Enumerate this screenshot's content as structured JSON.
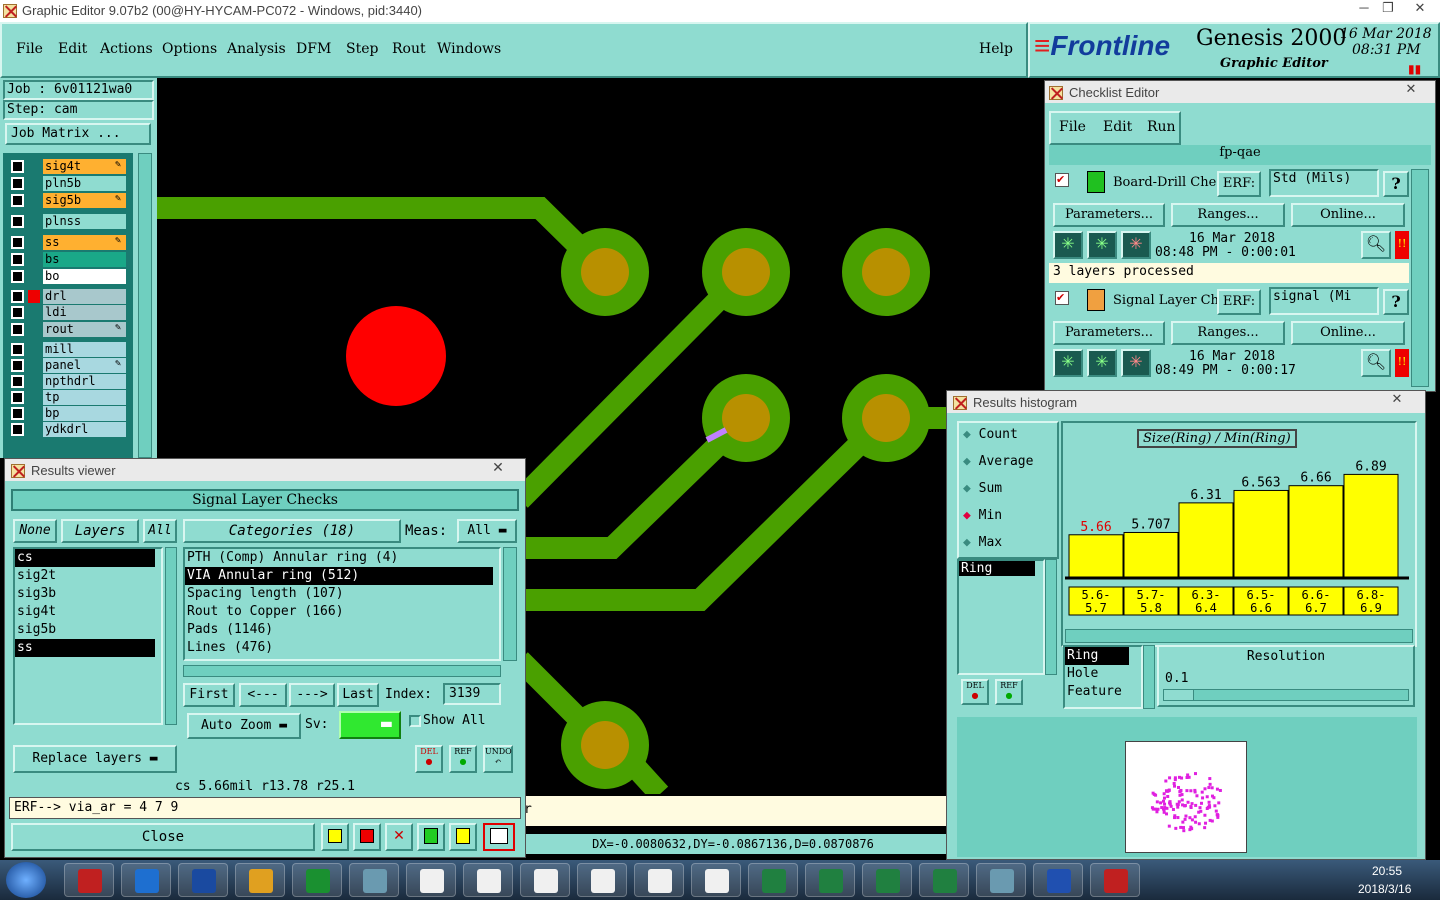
{
  "window": {
    "title": "Graphic Editor 9.07b2 (00@HY-HYCAM-PC072 - Windows, pid:3440)"
  },
  "menu": [
    "File",
    "Edit",
    "Actions",
    "Options",
    "Analysis",
    "DFM",
    "Step",
    "Rout",
    "Windows"
  ],
  "help": "Help",
  "brand": {
    "logo": "Frontline",
    "product": "Genesis 2000",
    "subtitle": "Graphic Editor",
    "date": "16 Mar 2018",
    "time": "08:31 PM"
  },
  "job": {
    "job_label": "Job : 6v01121wa0",
    "step_label": "Step: cam",
    "matrix_button": "Job Matrix ..."
  },
  "layers": [
    {
      "name": "sig4t",
      "color": "#ffb030",
      "edit": true
    },
    {
      "name": "pln5b",
      "color": "#8fdcd0",
      "edit": false
    },
    {
      "name": "sig5b",
      "color": "#ffb030",
      "edit": true
    },
    {
      "name": "plnss",
      "color": "#8fdcd0",
      "edit": false
    },
    {
      "name": "ss",
      "color": "#ffb030",
      "edit": true
    },
    {
      "name": "bs",
      "color": "#1aa888",
      "edit": false
    },
    {
      "name": "bo",
      "color": "#ffffff",
      "edit": false
    },
    {
      "name": "drl",
      "color": "#a8c8cc",
      "edit": false
    },
    {
      "name": "ldi",
      "color": "#a8c8cc",
      "edit": false
    },
    {
      "name": "rout",
      "color": "#a8c8cc",
      "edit": true
    },
    {
      "name": "mill",
      "color": "#a8d8e0",
      "edit": false
    },
    {
      "name": "panel",
      "color": "#a8d8e0",
      "edit": true
    },
    {
      "name": "npthdrl",
      "color": "#a8d8e0",
      "edit": false
    },
    {
      "name": "tp",
      "color": "#a8d8e0",
      "edit": false
    },
    {
      "name": "bp",
      "color": "#a8d8e0",
      "edit": false
    },
    {
      "name": "ydkdrl",
      "color": "#a8d8e0",
      "edit": false
    }
  ],
  "status_bar": {
    "delta": "DX=-0.0080632,DY=-0.0867136,D=0.0870876",
    "partial": "r"
  },
  "results_viewer": {
    "title": "Results viewer",
    "header": "Signal Layer Checks",
    "none_btn": "None",
    "layers_btn": "Layers",
    "all_btn": "All",
    "categories_btn": "Categories (18)",
    "meas_label": "Meas:",
    "meas_value": "All",
    "layer_list": [
      "cs",
      "sig2t",
      "sig3b",
      "sig4t",
      "sig5b",
      "ss"
    ],
    "categories": [
      "PTH (Comp) Annular ring (4)",
      "VIA Annular ring (512)",
      "Spacing length (107)",
      "Rout to Copper (166)",
      "Pads (1146)",
      "Lines (476)"
    ],
    "first": "First",
    "prev": "<---",
    "next": "--->",
    "last": "Last",
    "index_label": "Index:",
    "index_value": "3139",
    "auto_zoom": "Auto Zoom",
    "sv_label": "Sv:",
    "show_all": "Show All",
    "replace_layers": "Replace layers",
    "measure": "cs 5.66mil  r13.78  r25.1",
    "erf": "ERF--> via_ar = 4 7 9",
    "close": "Close",
    "del": "DEL",
    "ref": "REF",
    "undo": "UNDO"
  },
  "checklist": {
    "title": "Checklist Editor",
    "menu": [
      "File",
      "Edit",
      "Run"
    ],
    "name": "fp-qae",
    "checks": [
      {
        "name": "Board-Drill Che",
        "erf_label": "ERF:",
        "erf_value": "Std (Mils)",
        "date": "16 Mar 2018",
        "time": "08:48 PM - 0:00:01",
        "status": "3 layers processed"
      },
      {
        "name": "Signal Layer Ch",
        "erf_label": "ERF:",
        "erf_value": "signal (Mi",
        "date": "16 Mar 2018",
        "time": "08:49 PM - 0:00:17"
      }
    ],
    "params": "Parameters...",
    "ranges": "Ranges...",
    "online": "Online..."
  },
  "histogram": {
    "title": "Results histogram",
    "modes": [
      "Count",
      "Average",
      "Sum",
      "Min",
      "Max"
    ],
    "selected_mode": "Min",
    "heading": "Size(Ring) / Min(Ring)",
    "list_item": "Ring",
    "feature_list": [
      "Ring",
      "Hole",
      "Feature"
    ],
    "resolution_label": "Resolution",
    "resolution_value": "0.1",
    "del": "DEL",
    "ref": "REF"
  },
  "chart_data": {
    "type": "bar",
    "title": "Size(Ring) / Min(Ring)",
    "categories": [
      "5.6-5.7",
      "5.7-5.8",
      "6.3-6.4",
      "6.5-6.6",
      "6.6-6.7",
      "6.8-6.9"
    ],
    "values": [
      5.66,
      5.707,
      6.31,
      6.563,
      6.66,
      6.89
    ],
    "value_labels": [
      "5.66",
      "5.707",
      "6.31",
      "6.563",
      "6.66",
      "6.89"
    ],
    "ylim": [
      4.8,
      7.0
    ],
    "bar_color": "#ffff00",
    "first_label_color": "#e00000"
  },
  "taskbar": {
    "time": "20:55",
    "date": "2018/3/16"
  }
}
